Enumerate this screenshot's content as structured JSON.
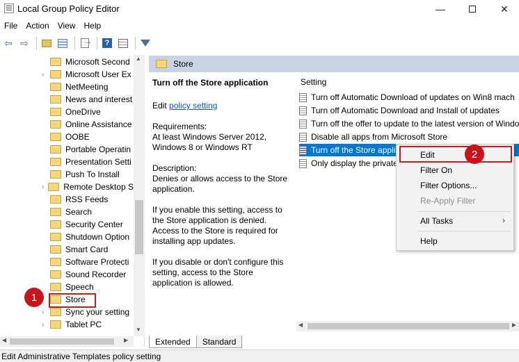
{
  "window": {
    "title": "Local Group Policy Editor",
    "minimize": "—",
    "close": "✕"
  },
  "menu": [
    "File",
    "Action",
    "View",
    "Help"
  ],
  "toolbar": {
    "icons": [
      "back-icon",
      "forward-icon",
      "up-folder-icon",
      "show-hide-tree-icon",
      "export-list-icon",
      "help-icon",
      "properties-icon",
      "filter-icon"
    ],
    "back": "⇦",
    "forward": "⇨",
    "help": "?"
  },
  "tree": {
    "items": [
      {
        "label": "Microsoft Second",
        "expandable": false
      },
      {
        "label": "Microsoft User Ex",
        "expandable": true
      },
      {
        "label": "NetMeeting",
        "expandable": false
      },
      {
        "label": "News and interest",
        "expandable": false
      },
      {
        "label": "OneDrive",
        "expandable": false
      },
      {
        "label": "Online Assistance",
        "expandable": false
      },
      {
        "label": "OOBE",
        "expandable": false
      },
      {
        "label": "Portable Operatin",
        "expandable": false
      },
      {
        "label": "Presentation Setti",
        "expandable": false
      },
      {
        "label": "Push To Install",
        "expandable": false
      },
      {
        "label": "Remote Desktop S",
        "expandable": true
      },
      {
        "label": "RSS Feeds",
        "expandable": false
      },
      {
        "label": "Search",
        "expandable": false
      },
      {
        "label": "Security Center",
        "expandable": false
      },
      {
        "label": "Shutdown Option",
        "expandable": false
      },
      {
        "label": "Smart Card",
        "expandable": false
      },
      {
        "label": "Software Protecti",
        "expandable": false
      },
      {
        "label": "Sound Recorder",
        "expandable": false
      },
      {
        "label": "Speech",
        "expandable": false
      },
      {
        "label": "Store",
        "expandable": false,
        "selected": true
      },
      {
        "label": "Sync your setting",
        "expandable": true
      },
      {
        "label": "Tablet PC",
        "expandable": true
      }
    ]
  },
  "right": {
    "header_title": "Store",
    "description": {
      "title": "Turn off the Store application",
      "edit_prefix": "Edit ",
      "edit_link": "policy setting",
      "requirements": "Requirements:\nAt least Windows Server 2012, Windows 8 or Windows RT",
      "description": "Description:\nDenies or allows access to the Store application.",
      "enable_text": "If you enable this setting, access to the Store application is denied. Access to the Store is required for installing app updates.",
      "disable_text": "If you disable or don't configure this setting, access to the Store application is allowed."
    },
    "list": {
      "header": "Setting",
      "rows": [
        {
          "label": "Turn off Automatic Download of updates on Win8 mach"
        },
        {
          "label": "Turn off Automatic Download and Install of updates"
        },
        {
          "label": "Turn off the offer to update to the latest version of Windo"
        },
        {
          "label": "Disable all apps from Microsoft Store"
        },
        {
          "label": "Turn off the Store appli",
          "selected": true
        },
        {
          "label": "Only display the private"
        }
      ]
    },
    "tabs": [
      "Extended",
      "Standard"
    ]
  },
  "context_menu": {
    "items": [
      {
        "label": "Edit"
      },
      {
        "label": "Filter On"
      },
      {
        "label": "Filter Options..."
      },
      {
        "label": "Re-Apply Filter",
        "disabled": true
      },
      {
        "label": "All Tasks",
        "submenu": true
      },
      {
        "label": "Help"
      }
    ],
    "submenu_arrow": "›"
  },
  "callouts": [
    "1",
    "2"
  ],
  "status": "Edit Administrative Templates policy setting",
  "colors": {
    "selection": "#0078d7",
    "highlight_border": "#c01d1d",
    "badge": "#c8141a",
    "header_bg": "#c8d4e3"
  }
}
